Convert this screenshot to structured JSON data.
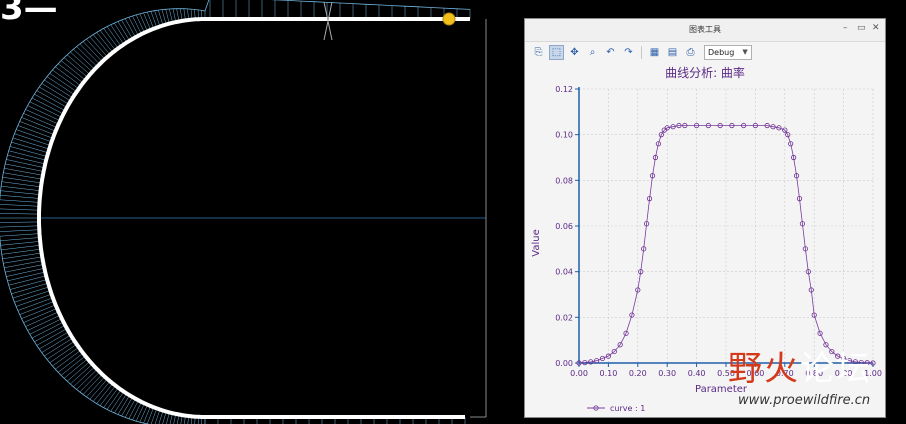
{
  "corner_text": "3—",
  "window": {
    "title": "图表工具",
    "controls": {
      "minimize": "–",
      "restore": "▭",
      "close": "✕"
    },
    "toolbar": {
      "debug_label": "Debug",
      "debug_arrow": "▼"
    }
  },
  "chart_data": {
    "type": "line",
    "title": "曲线分析: 曲率",
    "xlabel": "Parameter",
    "ylabel": "Value",
    "xlim": [
      0,
      1
    ],
    "ylim": [
      0,
      0.12
    ],
    "x_ticks": [
      "0.00",
      "0.10",
      "0.20",
      "0.30",
      "0.40",
      "0.50",
      "0.60",
      "0.70",
      "0.80",
      "0.90",
      "1.00"
    ],
    "y_ticks": [
      "0.00",
      "0.02",
      "0.04",
      "0.06",
      "0.08",
      "0.10",
      "0.12"
    ],
    "grid": true,
    "legend": "bottom-left",
    "series": [
      {
        "name": "curve : 1",
        "color": "#6b2c91",
        "x": [
          0.0,
          0.02,
          0.04,
          0.06,
          0.08,
          0.1,
          0.12,
          0.14,
          0.16,
          0.18,
          0.2,
          0.21,
          0.22,
          0.23,
          0.24,
          0.25,
          0.26,
          0.27,
          0.28,
          0.29,
          0.3,
          0.32,
          0.34,
          0.36,
          0.4,
          0.44,
          0.48,
          0.52,
          0.56,
          0.6,
          0.64,
          0.66,
          0.68,
          0.7,
          0.71,
          0.72,
          0.73,
          0.74,
          0.75,
          0.76,
          0.77,
          0.78,
          0.79,
          0.8,
          0.82,
          0.84,
          0.86,
          0.88,
          0.9,
          0.92,
          0.94,
          0.96,
          0.98,
          1.0
        ],
        "y": [
          0.0,
          0.0002,
          0.0005,
          0.001,
          0.002,
          0.003,
          0.005,
          0.008,
          0.013,
          0.021,
          0.032,
          0.04,
          0.05,
          0.061,
          0.072,
          0.082,
          0.09,
          0.096,
          0.1,
          0.102,
          0.103,
          0.1035,
          0.104,
          0.104,
          0.104,
          0.104,
          0.104,
          0.104,
          0.104,
          0.104,
          0.104,
          0.1035,
          0.103,
          0.102,
          0.1,
          0.096,
          0.09,
          0.082,
          0.072,
          0.061,
          0.05,
          0.04,
          0.032,
          0.021,
          0.013,
          0.008,
          0.005,
          0.003,
          0.002,
          0.001,
          0.0005,
          0.0002,
          0.0001,
          0.0
        ]
      }
    ]
  },
  "watermark": {
    "text_red": "野火",
    "text_white": "论坛",
    "url": "www.proewildfire.cn"
  }
}
